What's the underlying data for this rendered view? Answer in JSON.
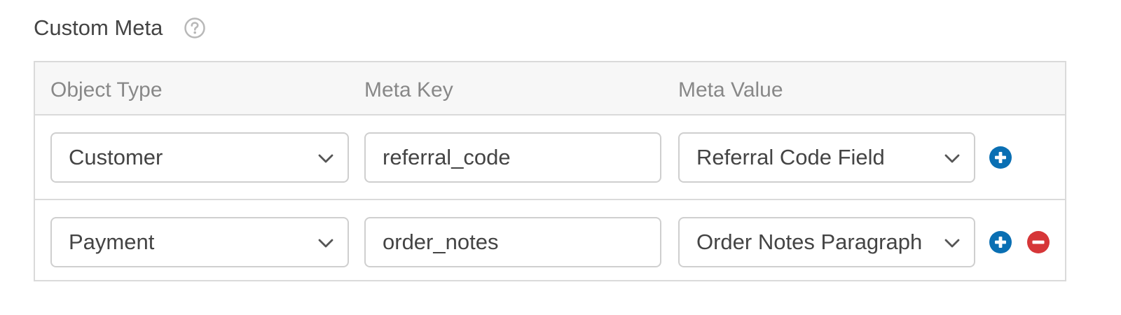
{
  "section": {
    "title": "Custom Meta",
    "help_icon": "question-circle-icon"
  },
  "columns": {
    "object_type": "Object Type",
    "meta_key": "Meta Key",
    "meta_value": "Meta Value"
  },
  "rows": [
    {
      "object_type": "Customer",
      "meta_key": "referral_code",
      "meta_value": "Referral Code Field",
      "actions": [
        "add"
      ]
    },
    {
      "object_type": "Payment",
      "meta_key": "order_notes",
      "meta_value": "Order Notes Paragraph",
      "actions": [
        "add",
        "remove"
      ]
    }
  ],
  "icons": {
    "add": "plus-circle-icon",
    "remove": "minus-circle-icon",
    "chevron": "chevron-down-icon"
  },
  "colors": {
    "add_button": "#0a6fb3",
    "remove_button": "#d63638",
    "border": "#cfcfcf",
    "header_bg": "#f7f7f7",
    "header_text": "#888888",
    "text": "#444444"
  }
}
